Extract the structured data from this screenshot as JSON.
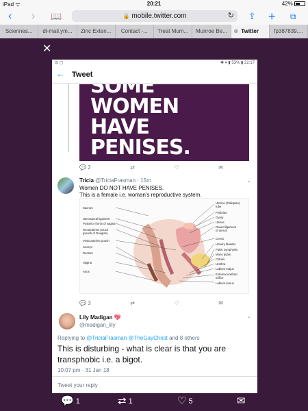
{
  "ios_status": {
    "carrier": "iPad",
    "time": "20:21",
    "battery": "42%"
  },
  "browser": {
    "url": "mobile.twitter.com",
    "tabs": [
      {
        "label": "Sciennes..."
      },
      {
        "label": "dl-mail.ym..."
      },
      {
        "label": "Zinc Exten..."
      },
      {
        "label": "Contact -..."
      },
      {
        "label": "Treat Mum..."
      },
      {
        "label": "Munroe Be..."
      },
      {
        "label": "Twitter",
        "active": true
      },
      {
        "label": "fp387839...."
      }
    ]
  },
  "phone": {
    "status_time": "22:17",
    "status_battery": "53%",
    "header_title": "Tweet",
    "poster_lines": [
      "SOME",
      "WOMEN",
      "HAVE",
      "PENISES."
    ],
    "first_actions": {
      "replies": "2"
    },
    "tweet1": {
      "name": "Tricia",
      "handle": "@TriciaFrasman",
      "time": "· 15m",
      "line1": "Women DO NOT HAVE PENISES.",
      "line2": "This is a female i.e. woman's reproductive system.",
      "replies": "3"
    },
    "diagram_labels": {
      "left": [
        "Sacrum",
        "Uterosacral ligament",
        "Posterior fornix of vagina",
        "Rectouterine pouch",
        "(pouch of Douglas)",
        "Vesicouterine pouch",
        "Coccyx",
        "Rectum",
        "Vagina",
        "Anus"
      ],
      "right": [
        "Uterine (Fallopian)",
        "tube",
        "Fimbriae",
        "Ovary",
        "Uterus",
        "Round ligament",
        "of uterus",
        "Cervix",
        "Urinary bladder",
        "Pubic symphysis",
        "Mons pubis",
        "Clitoris",
        "Urethra",
        "Labium majus",
        "External urethral",
        "orifice",
        "Labium minus"
      ]
    },
    "tweet2": {
      "name": "Lily Madigan",
      "emoji": "💖",
      "handle": "@madigan_lily",
      "replying_prefix": "Replying to",
      "replying_users": "@TriciaFrasman @TheGayChrist",
      "replying_suffix": "and 8 others",
      "text": "This is disturbing - what is clear is that you are transphobic i.e. a bigot.",
      "timestamp": "10:07 pm · 31 Jan 18"
    },
    "reply_placeholder": "Tweet your reply"
  },
  "bottom_actions": {
    "replies": "1",
    "retweets": "1",
    "likes": "5"
  },
  "colors": {
    "background": "#3a1a3a",
    "accent": "#1da1f2",
    "safari_blue": "#1a7cf5"
  }
}
